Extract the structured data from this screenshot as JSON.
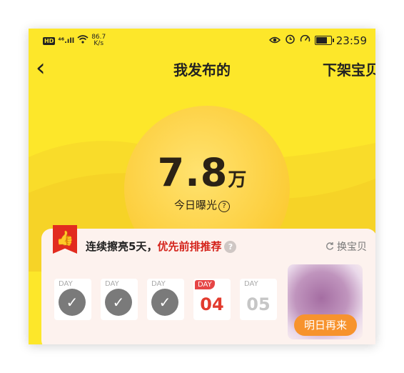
{
  "status_bar": {
    "hd": "HD",
    "signal": "⁴⁶.ıll",
    "speed_value": "86.7",
    "speed_unit": "K/s",
    "time": "23:59"
  },
  "nav": {
    "back_glyph": "‹",
    "title": "我发布的",
    "right_action": "下架宝贝"
  },
  "exposure": {
    "value": "7.8",
    "unit": "万",
    "label": "今日曝光",
    "help": "?"
  },
  "streak_card": {
    "thumb_icon": "👍",
    "text_prefix": "连续擦亮5天，",
    "text_highlight": "优先前排推荐",
    "help": "?",
    "swap_label": "换宝贝",
    "days": [
      {
        "tag": "DAY",
        "status": "done",
        "mark": "✓"
      },
      {
        "tag": "DAY",
        "status": "done",
        "mark": "✓"
      },
      {
        "tag": "DAY",
        "status": "done",
        "mark": "✓"
      },
      {
        "tag": "DAY",
        "status": "today",
        "number": "04"
      },
      {
        "tag": "DAY",
        "status": "pending",
        "number": "05"
      }
    ],
    "come_back_button": "明日再来"
  },
  "colors": {
    "background": "#fde72a",
    "accent_red": "#d4231b",
    "orange_button": "#f7932d"
  }
}
